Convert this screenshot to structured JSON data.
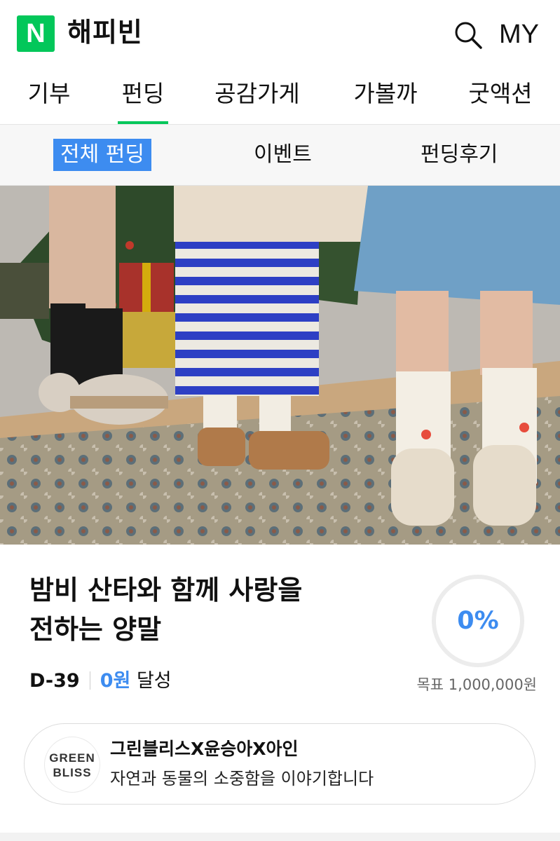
{
  "header": {
    "logo_letter": "N",
    "brand": "해피빈",
    "search_icon": "search-icon",
    "my_label": "MY"
  },
  "tabs": [
    {
      "label": "기부",
      "active": false
    },
    {
      "label": "펀딩",
      "active": true
    },
    {
      "label": "공감가게",
      "active": false
    },
    {
      "label": "가볼까",
      "active": false
    },
    {
      "label": "굿액션",
      "active": false
    }
  ],
  "subtabs": [
    {
      "label": "전체 펀딩",
      "active": true
    },
    {
      "label": "이벤트",
      "active": false
    },
    {
      "label": "펀딩후기",
      "active": false
    }
  ],
  "funding": {
    "title_line1": "밤비 산타와 함께 사랑을",
    "title_line2": "전하는 양말",
    "dday": "D-39",
    "amount": "0원",
    "achieve_label": "달성",
    "percent_text": "0%",
    "progress": 0,
    "goal": "목표 1,000,000원"
  },
  "organizer": {
    "logo_line1": "GREEN",
    "logo_line2": "BLISS",
    "name": "그린블리스X윤승아X아인",
    "description": "자연과 동물의 소중함을 이야기합니다"
  },
  "colors": {
    "brand_green": "#03c75a",
    "accent_blue": "#3d8cf0"
  }
}
